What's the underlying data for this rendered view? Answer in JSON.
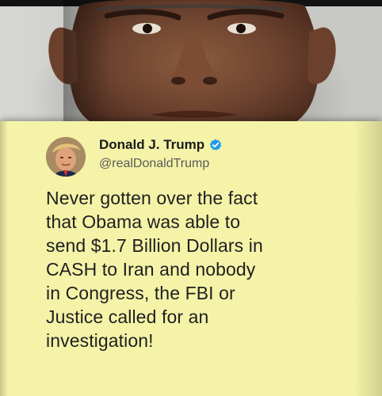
{
  "tweet": {
    "author_name": "Donald J. Trump",
    "handle": "@realDonaldTrump",
    "verified_icon": "verified-check-icon",
    "text_lines": [
      "Never gotten over the fact",
      "that Obama was able to",
      "send $1.7 Billion Dollars in",
      "CASH to Iran and nobody",
      "in Congress, the FBI or",
      "Justice called for an",
      "investigation!"
    ]
  },
  "colors": {
    "card_background": "#f4f3a8",
    "verified_badge": "#1d9bf0"
  }
}
